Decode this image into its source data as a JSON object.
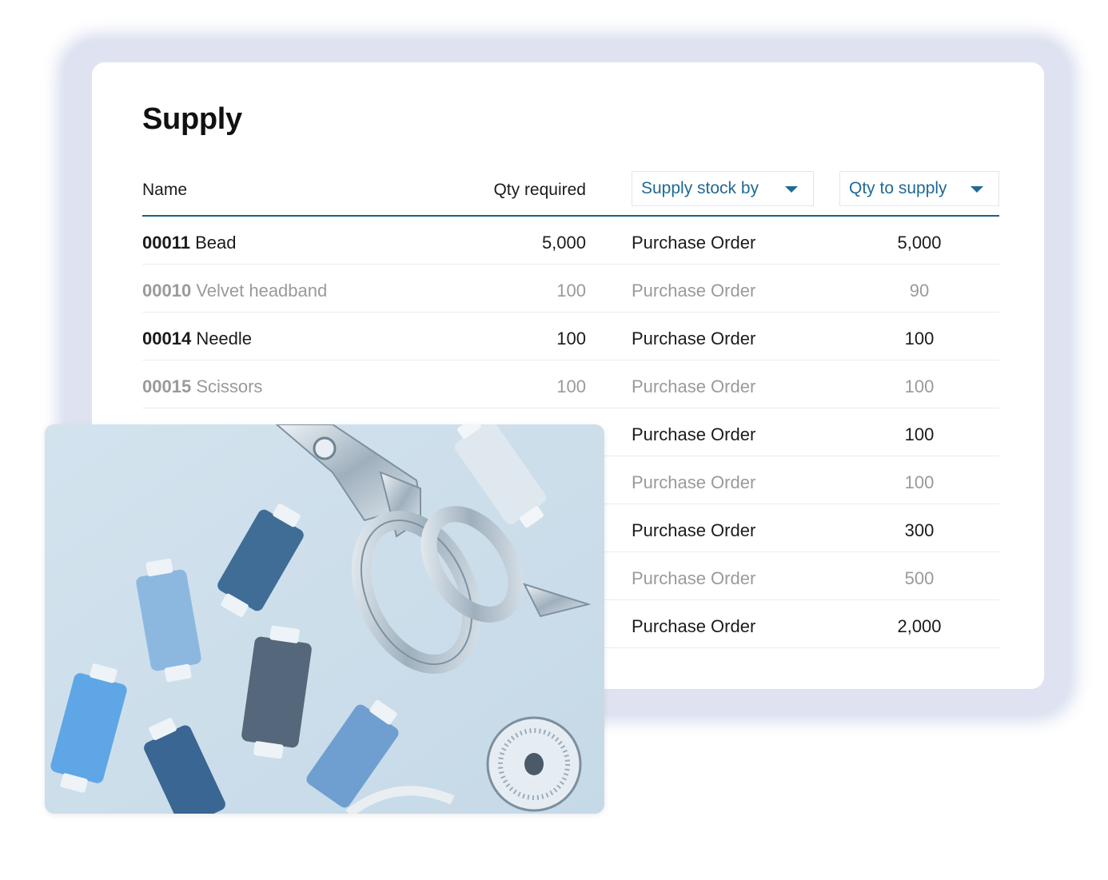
{
  "title": "Supply",
  "columns": {
    "name": "Name",
    "qty_required": "Qty required",
    "supply_stock_by": "Supply stock by",
    "qty_to_supply": "Qty to supply"
  },
  "rows": [
    {
      "code": "00011",
      "name": "Bead",
      "qty_required": "5,000",
      "supply_by": "Purchase Order",
      "qty_to_supply": "5,000",
      "muted": false
    },
    {
      "code": "00010",
      "name": "Velvet headband",
      "qty_required": "100",
      "supply_by": "Purchase Order",
      "qty_to_supply": "90",
      "muted": true
    },
    {
      "code": "00014",
      "name": "Needle",
      "qty_required": "100",
      "supply_by": "Purchase Order",
      "qty_to_supply": "100",
      "muted": false
    },
    {
      "code": "00015",
      "name": "Scissors",
      "qty_required": "100",
      "supply_by": "Purchase Order",
      "qty_to_supply": "100",
      "muted": true
    },
    {
      "code": "",
      "name": "",
      "qty_required": "",
      "supply_by": "Purchase Order",
      "qty_to_supply": "100",
      "muted": false
    },
    {
      "code": "",
      "name": "",
      "qty_required": "",
      "supply_by": "Purchase Order",
      "qty_to_supply": "100",
      "muted": true
    },
    {
      "code": "",
      "name": "",
      "qty_required": "",
      "supply_by": "Purchase Order",
      "qty_to_supply": "300",
      "muted": false
    },
    {
      "code": "",
      "name": "",
      "qty_required": "",
      "supply_by": "Purchase Order",
      "qty_to_supply": "500",
      "muted": true
    },
    {
      "code": "",
      "name": "",
      "qty_required": "",
      "supply_by": "Purchase Order",
      "qty_to_supply": "2,000",
      "muted": false
    }
  ],
  "colors": {
    "accent": "#1f6a95",
    "header_rule": "#1e5f86",
    "muted_text": "#9a9a9a",
    "photo_background": "#cfe0ec"
  },
  "photo": {
    "icon": "sewing-supplies-photo"
  }
}
